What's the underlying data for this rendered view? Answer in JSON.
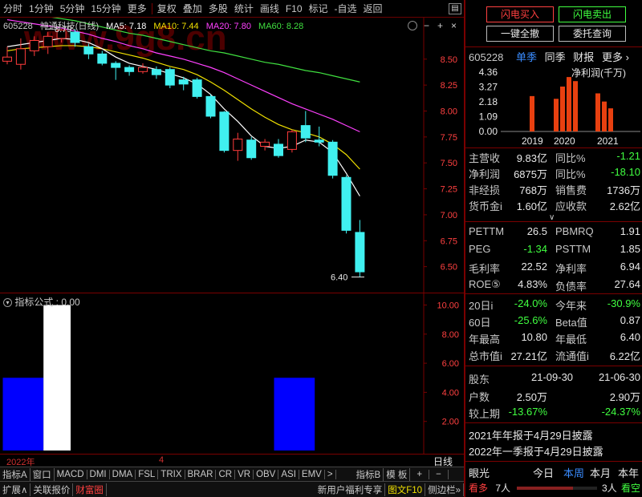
{
  "toolbar": {
    "items": [
      "分时",
      "1分钟",
      "5分钟",
      "15分钟",
      "更多",
      "复权",
      "叠加",
      "多股",
      "统计",
      "画线",
      "F10",
      "标记",
      "-自选",
      "返回"
    ]
  },
  "chart": {
    "stock_code": "605228",
    "stock_name": "神通科技(日线)",
    "ma5_label": "MA5: 7.18",
    "ma10_label": "MA10: 7.44",
    "ma20_label": "MA20: 7.80",
    "ma60_label": "MA60: 8.28",
    "watermark": "www.9g8.cn",
    "high_label": "8.79",
    "low_label": "6.40",
    "colors": {
      "up": "#ff3b3b",
      "down": "#40f0f0",
      "ma5": "#ffffff",
      "ma10": "#f0e000",
      "ma20": "#ff40ff",
      "ma60": "#40e040",
      "grid": "#7a0000",
      "axis_text": "#ff4040"
    }
  },
  "chart_data": [
    {
      "type": "candlestick",
      "ylim": [
        6.25,
        8.9
      ],
      "y_ticks": [
        "8.50",
        "8.25",
        "8.00",
        "7.75",
        "7.50",
        "7.25",
        "7.00",
        "6.75",
        "6.50"
      ],
      "candles": [
        {
          "o": 8.48,
          "c": 8.52,
          "h": 8.62,
          "l": 8.45
        },
        {
          "o": 8.45,
          "c": 8.6,
          "h": 8.7,
          "l": 8.4
        },
        {
          "o": 8.58,
          "c": 8.68,
          "h": 8.72,
          "l": 8.53
        },
        {
          "o": 8.62,
          "c": 8.72,
          "h": 8.76,
          "l": 8.55
        },
        {
          "o": 8.7,
          "c": 8.78,
          "h": 8.79,
          "l": 8.66
        },
        {
          "o": 8.76,
          "c": 8.66,
          "h": 8.79,
          "l": 8.62
        },
        {
          "o": 8.62,
          "c": 8.55,
          "h": 8.65,
          "l": 8.5
        },
        {
          "o": 8.55,
          "c": 8.46,
          "h": 8.58,
          "l": 8.44
        },
        {
          "o": 8.46,
          "c": 8.42,
          "h": 8.48,
          "l": 8.3
        },
        {
          "o": 8.42,
          "c": 8.38,
          "h": 8.44,
          "l": 8.34
        },
        {
          "o": 8.38,
          "c": 8.42,
          "h": 8.46,
          "l": 8.36
        },
        {
          "o": 8.4,
          "c": 8.35,
          "h": 8.43,
          "l": 8.31
        },
        {
          "o": 8.4,
          "c": 8.25,
          "h": 8.42,
          "l": 8.22
        },
        {
          "o": 8.3,
          "c": 8.26,
          "h": 8.33,
          "l": 8.2
        },
        {
          "o": 8.3,
          "c": 8.14,
          "h": 8.32,
          "l": 8.12
        },
        {
          "o": 8.14,
          "c": 7.95,
          "h": 8.16,
          "l": 7.93
        },
        {
          "o": 7.99,
          "c": 7.62,
          "h": 8.0,
          "l": 7.6
        },
        {
          "o": 7.62,
          "c": 7.73,
          "h": 7.79,
          "l": 7.52
        },
        {
          "o": 7.72,
          "c": 7.55,
          "h": 7.75,
          "l": 7.53
        },
        {
          "o": 7.66,
          "c": 7.7,
          "h": 7.73,
          "l": 7.62
        },
        {
          "o": 7.68,
          "c": 7.57,
          "h": 7.73,
          "l": 7.55
        },
        {
          "o": 7.63,
          "c": 7.8,
          "h": 7.82,
          "l": 7.6
        },
        {
          "o": 7.86,
          "c": 7.74,
          "h": 8.0,
          "l": 7.7
        },
        {
          "o": 7.72,
          "c": 7.7,
          "h": 7.85,
          "l": 7.66
        },
        {
          "o": 7.7,
          "c": 7.38,
          "h": 7.72,
          "l": 7.35
        },
        {
          "o": 7.36,
          "c": 6.85,
          "h": 7.38,
          "l": 6.82
        },
        {
          "o": 6.83,
          "c": 6.45,
          "h": 6.95,
          "l": 6.4
        }
      ],
      "ma5": [
        8.62,
        8.64,
        8.66,
        8.68,
        8.7,
        8.69,
        8.66,
        8.6,
        8.52,
        8.46,
        8.43,
        8.4,
        8.36,
        8.32,
        8.26,
        8.16,
        8.02,
        7.9,
        7.76,
        7.66,
        7.64,
        7.66,
        7.72,
        7.7,
        7.6,
        7.4,
        7.18
      ],
      "ma10": [
        8.58,
        8.6,
        8.61,
        8.62,
        8.63,
        8.63,
        8.62,
        8.6,
        8.57,
        8.54,
        8.51,
        8.47,
        8.43,
        8.4,
        8.35,
        8.28,
        8.2,
        8.11,
        8.02,
        7.94,
        7.87,
        7.82,
        7.79,
        7.75,
        7.68,
        7.58,
        7.44
      ],
      "ma20": [
        8.88,
        8.86,
        8.84,
        8.82,
        8.8,
        8.77,
        8.74,
        8.7,
        8.67,
        8.63,
        8.6,
        8.56,
        8.53,
        8.5,
        8.46,
        8.42,
        8.37,
        8.31,
        8.25,
        8.19,
        8.13,
        8.07,
        8.02,
        7.97,
        7.92,
        7.86,
        7.8
      ],
      "ma60": [
        8.95,
        8.94,
        8.93,
        8.91,
        8.89,
        8.87,
        8.84,
        8.81,
        8.78,
        8.75,
        8.73,
        8.7,
        8.67,
        8.64,
        8.61,
        8.58,
        8.56,
        8.53,
        8.5,
        8.47,
        8.45,
        8.42,
        8.39,
        8.37,
        8.34,
        8.31,
        8.28
      ]
    },
    {
      "type": "bar",
      "title": "指标公式 : 0.00",
      "ylim": [
        0,
        10.8
      ],
      "y_ticks": [
        "10.00",
        "8.00",
        "6.00",
        "4.00",
        "2.00"
      ],
      "bars": [
        {
          "start": 0,
          "end": 3,
          "value": 5.0,
          "color": "#0000ff"
        },
        {
          "start": 3,
          "end": 5,
          "value": 10.0,
          "color": "#ffffff"
        },
        {
          "start": 20,
          "end": 23,
          "value": 5.0,
          "color": "#0000ff"
        }
      ]
    },
    {
      "type": "bar",
      "title": "净利润(千万)",
      "y_ticks": [
        "4.36",
        "3.27",
        "2.18",
        "1.09",
        "0.00"
      ],
      "ylim": [
        0,
        4.36
      ],
      "categories": [
        "2019",
        "2020",
        "2021"
      ],
      "values": [
        2.6,
        2.4,
        3.3,
        4.0,
        3.7,
        2.8,
        2.2,
        1.7
      ]
    }
  ],
  "bottom": {
    "date_left": "2022年",
    "date_mid": "4",
    "period": "日线",
    "tabs": [
      "指标A",
      "窗口",
      "MACD",
      "DMI",
      "DMA",
      "FSL",
      "TRIX",
      "BRAR",
      "CR",
      "VR",
      "OBV",
      "ASI",
      "EMV",
      ">",
      "指标B",
      "模 板",
      "+",
      "−"
    ],
    "status": [
      "扩展∧",
      "关联报价",
      "财富圈",
      "新用户福利专享",
      "图文F10",
      "侧边栏»"
    ]
  },
  "right": {
    "buttons": {
      "flash_buy": "闪电买入",
      "flash_sell": "闪电卖出",
      "clear_all": "一键全撤",
      "entrust_query": "委托查询"
    },
    "code": "605228",
    "view_tabs": [
      "单季",
      "同季",
      "财报",
      "更多"
    ],
    "bar_chart_title": "净利润(千万)",
    "finance": [
      {
        "l1": "主营收",
        "v1": "9.83亿",
        "l2": "同比%",
        "v2": "-1.21"
      },
      {
        "l1": "净利润",
        "v1": "6875万",
        "l2": "同比%",
        "v2": "-18.10"
      },
      {
        "l1": "非经损",
        "v1": "768万",
        "l2": "销售费",
        "v2": "1736万"
      },
      {
        "l1": "货币金i",
        "v1": "1.60亿",
        "l2": "应收款",
        "v2": "2.62亿"
      }
    ],
    "valuation": [
      {
        "l1": "PETTM",
        "v1": "26.5",
        "l2": "PBMRQ",
        "v2": "1.91"
      },
      {
        "l1": "PEG",
        "v1": "-1.34",
        "l2": "PSTTM",
        "v2": "1.85"
      },
      {
        "l1": "毛利率",
        "v1": "22.52",
        "l2": "净利率",
        "v2": "6.94"
      },
      {
        "l1": "ROE⑤",
        "v1": "4.83%",
        "l2": "负债率",
        "v2": "27.64"
      }
    ],
    "market": [
      {
        "l1": "20日i",
        "v1": "-24.0%",
        "l2": "今年来",
        "v2": "-30.9%"
      },
      {
        "l1": "60日",
        "v1": "-25.6%",
        "l2": "Beta值",
        "v2": "0.87"
      },
      {
        "l1": "年最高",
        "v1": "10.80",
        "l2": "年最低",
        "v2": "6.40"
      },
      {
        "l1": "总市值i",
        "v1": "27.21亿",
        "l2": "流通值i",
        "v2": "6.22亿"
      }
    ],
    "holders_header": {
      "label": "股东",
      "d1": "21-09-30",
      "d2": "21-06-30"
    },
    "holders": [
      {
        "label": "户数",
        "v1": "2.50万",
        "v2": "2.90万"
      },
      {
        "label": "较上期",
        "v1": "-13.67%",
        "v2": "-24.37%"
      }
    ],
    "reports": [
      "2021年年报于4月29日披露",
      "2022年一季报于4月29日披露"
    ],
    "eyelight": {
      "label": "眼光",
      "tabs": [
        "今日",
        "本周",
        "本月",
        "本年"
      ]
    },
    "sentiment": {
      "bull_label": "看多",
      "bull_count": "7人",
      "bear_count": "3人",
      "bear_label": "看空"
    }
  }
}
